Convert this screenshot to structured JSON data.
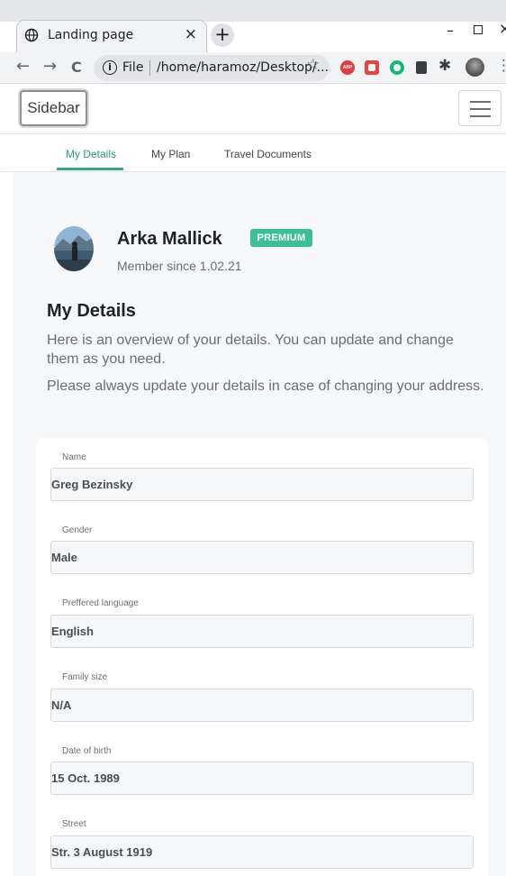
{
  "browser": {
    "tab_title": "Landing page",
    "tab_close": "×",
    "new_tab": "+",
    "window_minimize": "–",
    "window_close": "×",
    "nav_back": "←",
    "nav_forward": "→",
    "nav_reload": "C",
    "info_glyph": "i",
    "file_label": "File",
    "url": "/home/haramoz/Desktop/...",
    "bookmark_star": "☆",
    "extensions": [
      "adblock-icon",
      "red-extension-icon",
      "grammarly-icon",
      "cube-extension-icon",
      "puzzle-icon",
      "profile-avatar-icon"
    ],
    "abp_label": "ABP",
    "puzzle_glyph": "✱",
    "kebab_glyph": "⋮"
  },
  "navbar": {
    "sidebar_label": "Sidebar"
  },
  "tabs": [
    {
      "label": "My Details",
      "active": true
    },
    {
      "label": "My Plan",
      "active": false
    },
    {
      "label": "Travel Documents",
      "active": false
    }
  ],
  "profile": {
    "name": "Arka Mallick",
    "badge": "PREMIUM",
    "member_since": "Member since 1.02.21"
  },
  "details": {
    "heading": "My Details",
    "description_1": "Here is an overview of your details. You can update and change them as you need.",
    "description_2": "Please always update your details in case of changing your address."
  },
  "fields": {
    "name": {
      "label": "Name",
      "value": "Greg Bezinsky"
    },
    "gender": {
      "label": "Gender",
      "value": "Male"
    },
    "language": {
      "label": "Preffered language",
      "value": "English"
    },
    "family_size": {
      "label": "Family size",
      "value": "N/A"
    },
    "dob": {
      "label": "Date of birth",
      "value": "15 Oct. 1989"
    },
    "street": {
      "label": "Street",
      "value": "Str. 3 August 1919"
    }
  },
  "colors": {
    "accent": "#34a884",
    "badge": "#3cbf97",
    "page_background": "#f6f7f9"
  }
}
